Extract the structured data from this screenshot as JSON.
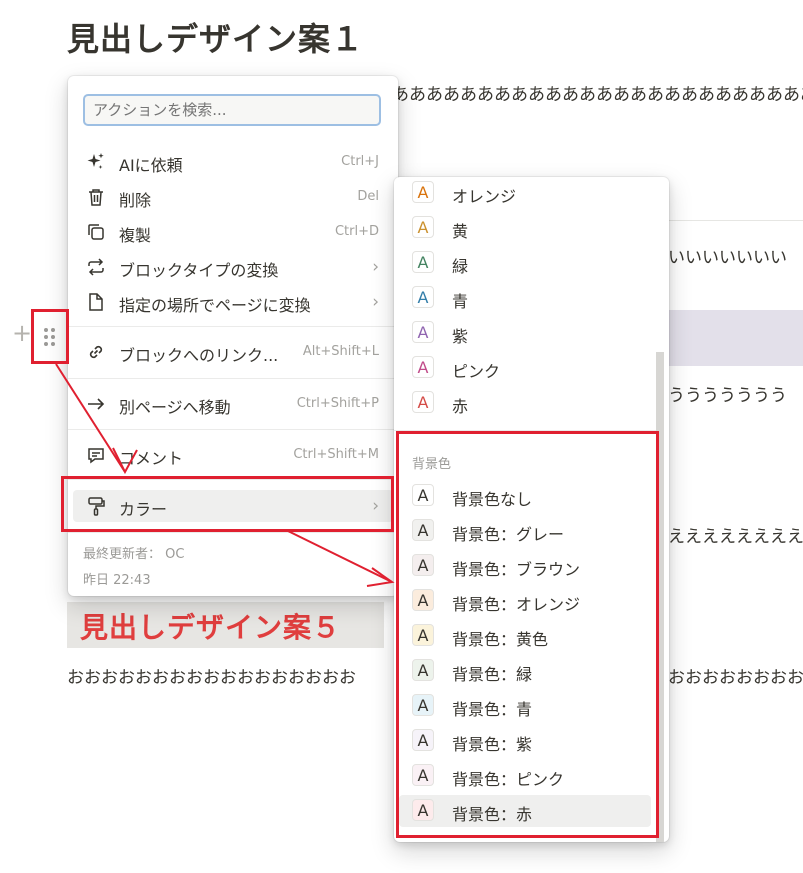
{
  "page": {
    "heading1": "見出しデザイン案１",
    "line_a": "あああああああああああああああああああああああああ",
    "line_i": "いいいいいいい",
    "line_u": "ううううううう",
    "line_e": "ええええええええ",
    "heading5": "見出しデザイン案５",
    "line_o_left": "おおおおおおおおおおおおおおおおお",
    "line_o_right": "おおおおおおおお"
  },
  "block_handle": {
    "plus_icon": "plus-icon",
    "drag_icon": "drag-handle-icon"
  },
  "action_menu": {
    "search_placeholder": "アクションを検索...",
    "items": [
      {
        "icon": "sparkle-icon",
        "label": "AIに依頼",
        "shortcut": "Ctrl+J"
      },
      {
        "icon": "trash-icon",
        "label": "削除",
        "shortcut": "Del"
      },
      {
        "icon": "duplicate-icon",
        "label": "複製",
        "shortcut": "Ctrl+D"
      },
      {
        "icon": "convert-icon",
        "label": "ブロックタイプの変換",
        "shortcut": ""
      },
      {
        "icon": "page-icon",
        "label": "指定の場所でページに変換",
        "shortcut": ""
      },
      {
        "icon": "link-icon",
        "label": "ブロックへのリンク...",
        "shortcut": "Alt+Shift+L"
      },
      {
        "icon": "move-arrow-icon",
        "label": "別ページへ移動",
        "shortcut": "Ctrl+Shift+P"
      },
      {
        "icon": "comment-icon",
        "label": "コメント",
        "shortcut": "Ctrl+Shift+M"
      },
      {
        "icon": "paint-roller-icon",
        "label": "カラー",
        "shortcut": ""
      }
    ],
    "last_edited_by": "最終更新者： OC",
    "last_edited_time": "昨日 22:43"
  },
  "color_menu": {
    "text_colors": [
      {
        "label": "オレンジ",
        "color": "#d9730d"
      },
      {
        "label": "黄",
        "color": "#cb912f"
      },
      {
        "label": "緑",
        "color": "#448361"
      },
      {
        "label": "青",
        "color": "#337ea9"
      },
      {
        "label": "紫",
        "color": "#9065b0"
      },
      {
        "label": "ピンク",
        "color": "#c14c8a"
      },
      {
        "label": "赤",
        "color": "#d44c47"
      }
    ],
    "background_heading": "背景色",
    "background_colors": [
      {
        "label": "背景色なし",
        "bg": "#ffffff"
      },
      {
        "label": "背景色：グレー",
        "bg": "#f1f1ef"
      },
      {
        "label": "背景色：ブラウン",
        "bg": "#f4eeee"
      },
      {
        "label": "背景色：オレンジ",
        "bg": "#fbecdd"
      },
      {
        "label": "背景色：黄色",
        "bg": "#fbf3db"
      },
      {
        "label": "背景色：緑",
        "bg": "#edf3ec"
      },
      {
        "label": "背景色：青",
        "bg": "#e7f3f8"
      },
      {
        "label": "背景色：紫",
        "bg": "#f6f3f9"
      },
      {
        "label": "背景色：ピンク",
        "bg": "#faf1f5"
      },
      {
        "label": "背景色：赤",
        "bg": "#fdebec"
      }
    ],
    "swatch_letter": "A"
  },
  "annotation_color": "#e02030"
}
